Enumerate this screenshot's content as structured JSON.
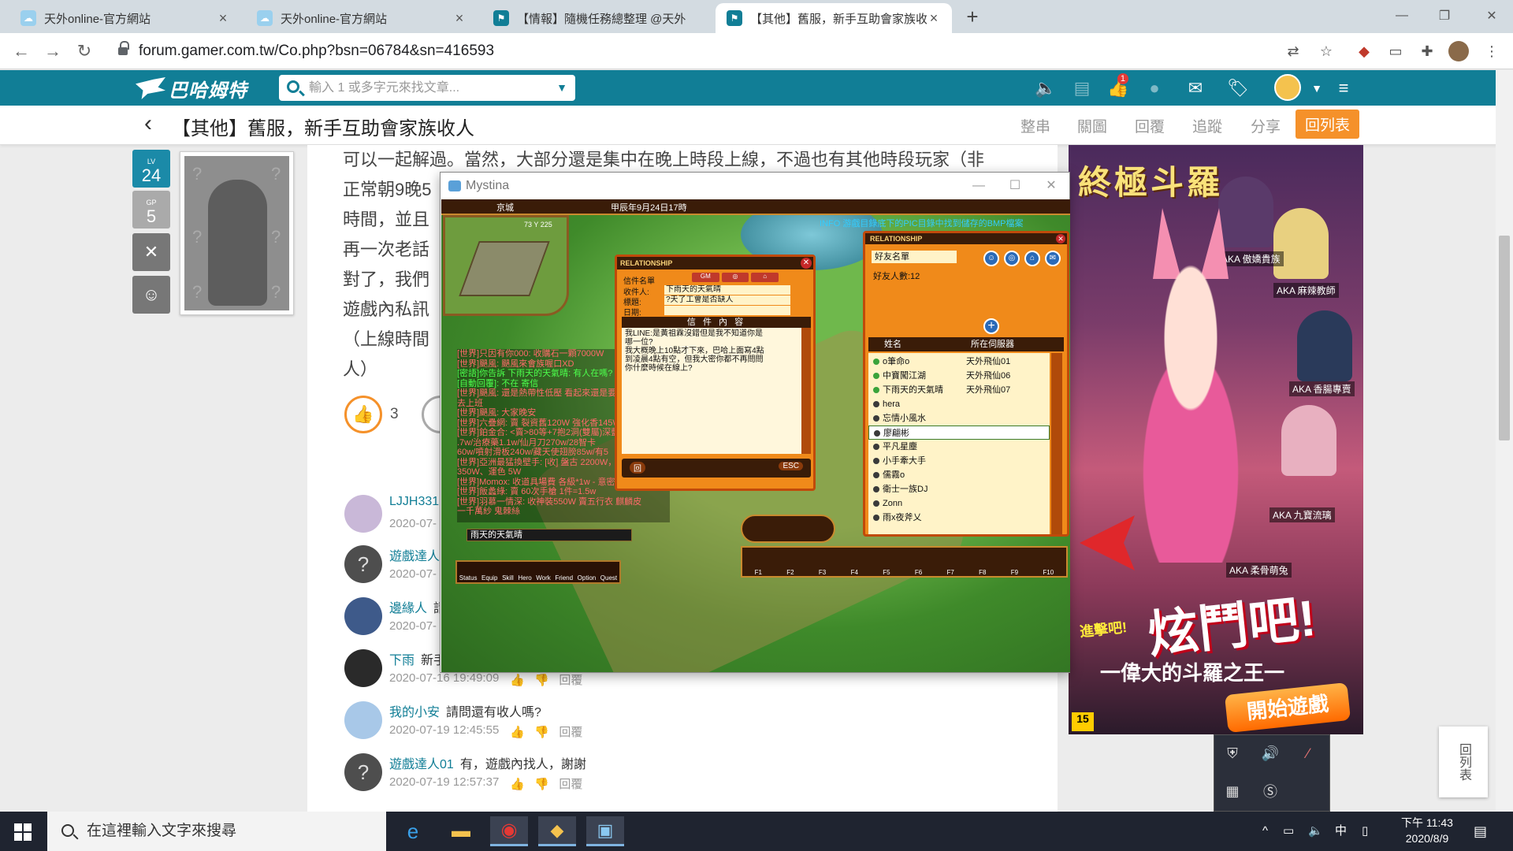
{
  "browser": {
    "tabs": [
      {
        "title": "天外online-官方網站"
      },
      {
        "title": "天外online-官方網站"
      },
      {
        "title": "【情報】隨機任務總整理 @天外"
      },
      {
        "title": "【其他】舊服，新手互助會家族收人"
      }
    ],
    "url": "forum.gamer.com.tw/Co.php?bsn=06784&sn=416593"
  },
  "site": {
    "logo": "巴哈姆特",
    "search_placeholder": "輸入 1 或多字元來找文章...",
    "notif_count": "1"
  },
  "titlebar": {
    "title": "【其他】舊服，新手互助會家族收人",
    "buttons": [
      "整串",
      "關圖",
      "回覆",
      "追蹤",
      "分享"
    ],
    "back_to_list": "回列表"
  },
  "user": {
    "level_label": "LV",
    "level": "24",
    "gp_label": "GP",
    "gp": "5"
  },
  "article": {
    "lines": [
      "可以一起解過。當然，大部分還是集中在晚上時段上線，不過也有其他時段玩家（非",
      "正常朝9晚5",
      "時間，並且",
      "再一次老話",
      "對了，我們",
      "遊戲內私訊",
      "（上線時間",
      "人）"
    ],
    "likes": "3"
  },
  "comments": [
    {
      "name": "LJJH331",
      "text": "",
      "time": "2020-07-"
    },
    {
      "name": "遊戲達人",
      "text": "",
      "time": "2020-07-"
    },
    {
      "name": "邊緣人",
      "text": "請",
      "time": "2020-07-"
    },
    {
      "name": "下雨",
      "text": "新手",
      "time": "2020-07-16 19:49:09"
    },
    {
      "name": "我的小安",
      "text": "請問還有收人嗎?",
      "time": "2020-07-19 12:45:55"
    },
    {
      "name": "遊戲達人01",
      "text": "有，遊戲內找人，謝謝",
      "time": "2020-07-19 12:57:37"
    }
  ],
  "comment_reply": "回覆",
  "game": {
    "window_title": "Mystina",
    "location": "京城",
    "datetime": "甲辰年9月24日17時",
    "coords": "73 Y 225",
    "info": "INFO 游戲目錄底下的PIC目錄中找到儲存的BMP檔案",
    "chat_log": [
      {
        "text": "[世界]只因有你000: 收購石一顆7000W",
        "green": false
      },
      {
        "text": "[世界]颶風: 颶風來會族喔口XD",
        "green": false
      },
      {
        "text": "[密語]你告訴 下雨天的天氣晴: 有人在嗎?",
        "green": true
      },
      {
        "text": "[自動回覆]: 不在 寄信",
        "green": true
      },
      {
        "text": "[世界]颶風: 還是熱帶性低壓 看起來還是要",
        "green": false
      },
      {
        "text": "      去上班",
        "green": false
      },
      {
        "text": "[世界]颶風: 大家晚安",
        "green": false
      },
      {
        "text": "[世界]六疊網: 賣 裂資舊120W 強化香145W",
        "green": false
      },
      {
        "text": "[世界]鉑金合: <賣>80等+7抱2洞(雙屬)深藍",
        "green": false
      },
      {
        "text": "   .7w/治療藥1.1w/仙月刀270w/28智卡",
        "green": false
      },
      {
        "text": "   60w/噴射滑板240w/藏天使翅膀85w/有5",
        "green": false
      },
      {
        "text": "[世界]亞洲最猛換壁手: [收] 盤古 2200W，典章",
        "green": false
      },
      {
        "text": "   350W、運色 5W",
        "green": false
      },
      {
        "text": "[世界]Momox: 收道具場費 各級*1w - 意密",
        "green": false
      },
      {
        "text": "[世界]飯蠡綠: 賣 60次手槍 1件=1.5w",
        "green": false
      },
      {
        "text": "[世界]羽慕一情深: 收神裝550W 賣五行衣 麒麟皮",
        "green": false
      },
      {
        "text": "   一千萬紗 鬼棘絲",
        "green": false
      }
    ],
    "chat_input": "雨天的天氣晴",
    "menu": [
      "Status",
      "Equip",
      "Skill",
      "Hero",
      "Work",
      "Friend",
      "Option",
      "Quest"
    ],
    "hotkeys": [
      "F1",
      "F2",
      "F3",
      "F4",
      "F5",
      "F6",
      "F7",
      "F8",
      "F9",
      "F10"
    ],
    "mail": {
      "header": "RELATIONSHIP",
      "gm_buttons": [
        "GM",
        "◎",
        "⌂"
      ],
      "label_letter": "信件名單",
      "label_to": "收件人:",
      "label_subject": "標題:",
      "label_date": "日期:",
      "to": "下雨天的天氣晴",
      "subject": "?天了工會是否缺人",
      "date": "",
      "body_header": "信 件 內 容",
      "body": "我LINE:是黃祖霖沒錯但是我不知道你是\n哪一位?\n我大概晚上10點才下來，巴哈上面寫4點\n到凌晨4點有空，但我大密你都不再問問\n你什麼時候在線上?",
      "send": "回",
      "esc": "ESC"
    },
    "friends": {
      "header": "RELATIONSHIP",
      "list_name": "好友名單",
      "count_label": "好友人數:12",
      "col_name": "姓名",
      "col_server": "所在伺服器",
      "list": [
        {
          "name": "o筆命o",
          "server": "天外飛仙01",
          "online": true
        },
        {
          "name": "中寶闖江湖",
          "server": "天外飛仙06",
          "online": true
        },
        {
          "name": "下雨天的天氣晴",
          "server": "天外飛仙07",
          "online": true
        },
        {
          "name": "hera",
          "server": "",
          "online": false
        },
        {
          "name": "忘情小風水",
          "server": "",
          "online": false
        },
        {
          "name": "廖翩彬",
          "server": "",
          "online": false
        },
        {
          "name": "平凡星塵",
          "server": "",
          "online": false
        },
        {
          "name": "小手牽大手",
          "server": "",
          "online": false
        },
        {
          "name": "儒霧o",
          "server": "",
          "online": false
        },
        {
          "name": "衛士一族DJ",
          "server": "",
          "online": false
        },
        {
          "name": "Zonn",
          "server": "",
          "online": false
        },
        {
          "name": "雨x夜斧乂",
          "server": "",
          "online": false
        }
      ],
      "selected_index": 5
    }
  },
  "ad": {
    "title": "終極斗羅",
    "slogan": "炫鬥吧!",
    "prefix": "進擊吧!",
    "sub": "一偉大的斗羅之王一",
    "cta": "開始遊戲",
    "rating": "15",
    "tags": [
      "AKA 傲嬌貴族",
      "AKA 麻辣教師",
      "AKA 香腸專賣",
      "AKA 九寶流璃",
      "AKA 柔骨萌兔"
    ]
  },
  "back_list_side": "回列表",
  "taskbar": {
    "search_placeholder": "在這裡輸入文字來搜尋",
    "time": "下午 11:43",
    "date": "2020/8/9",
    "ime": "中"
  }
}
